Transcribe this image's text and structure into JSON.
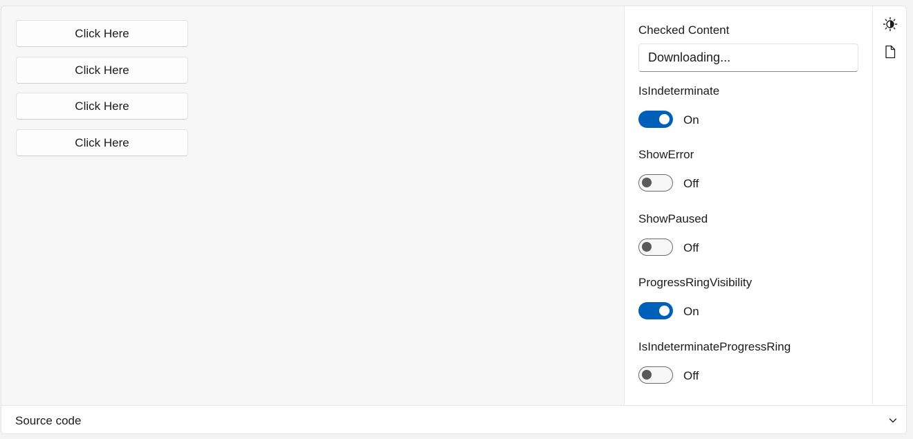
{
  "example": {
    "buttons": [
      "Click Here",
      "Click Here",
      "Click Here",
      "Click Here"
    ]
  },
  "options": {
    "checked_content_label": "Checked Content",
    "checked_content_value": "Downloading...",
    "toggles": [
      {
        "label": "IsIndeterminate",
        "state": "On",
        "on": true
      },
      {
        "label": "ShowError",
        "state": "Off",
        "on": false
      },
      {
        "label": "ShowPaused",
        "state": "Off",
        "on": false
      },
      {
        "label": "ProgressRingVisibility",
        "state": "On",
        "on": true
      },
      {
        "label": "IsIndeterminateProgressRing",
        "state": "Off",
        "on": false
      }
    ]
  },
  "rail": {
    "icons": [
      "theme-toggle-icon",
      "document-icon"
    ]
  },
  "footer": {
    "label": "Source code"
  },
  "colors": {
    "accent": "#005fb8",
    "knob_off": "#5a5a5a"
  }
}
